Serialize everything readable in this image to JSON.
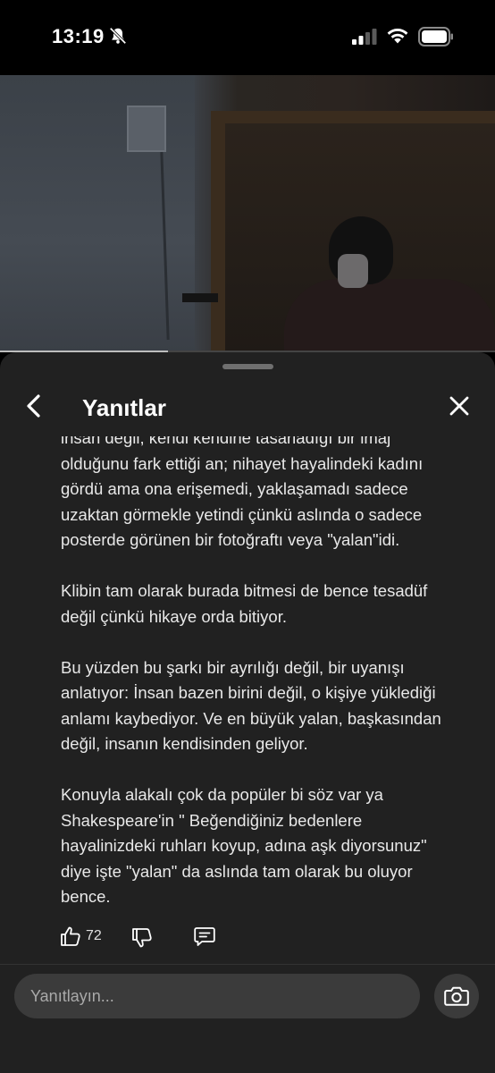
{
  "status_bar": {
    "time": "13:19",
    "icons": [
      "bell-slash-icon",
      "signal-icon",
      "wifi-icon",
      "battery-icon"
    ]
  },
  "video": {
    "progress": 0.34
  },
  "sheet": {
    "title": "Yanıtlar",
    "back_icon": "chevron-left-icon",
    "close_icon": "close-icon"
  },
  "comment": {
    "paragraphs": [
      "insan değil, kendi kendine tasarladığı bir imaj olduğunu fark ettiği an; nihayet hayalindeki kadını gördü ama ona erişemedi, yaklaşamadı sadece uzaktan görmekle yetindi çünkü aslında o sadece posterde görünen bir fotoğraftı veya \"yalan\"idi.",
      "Klibin tam olarak burada bitmesi de bence tesadüf değil çünkü hikaye orda bitiyor.",
      "Bu yüzden bu şarkı bir ayrılığı değil, bir uyanışı anlatıyor: İnsan bazen birini değil, o kişiye yüklediği anlamı kaybediyor. Ve en büyük yalan, başkasından değil, insanın kendisinden geliyor.",
      "Konuyla alakalı çok da popüler bi söz var ya Shakespeare'in \" Beğendiğiniz bedenlere hayalinizdeki ruhları koyup, adına aşk diyorsunuz\" diye işte \"yalan\" da aslında tam olarak bu oluyor bence."
    ],
    "like_count": "72",
    "action_icons": [
      "thumbs-up-icon",
      "thumbs-down-icon",
      "comment-icon"
    ]
  },
  "reply": {
    "placeholder": "Yanıtlayın...",
    "camera_icon": "camera-icon"
  },
  "colors": {
    "sheet_bg": "#212121",
    "input_bg": "#3b3b3b",
    "text": "#e8e8e8"
  }
}
